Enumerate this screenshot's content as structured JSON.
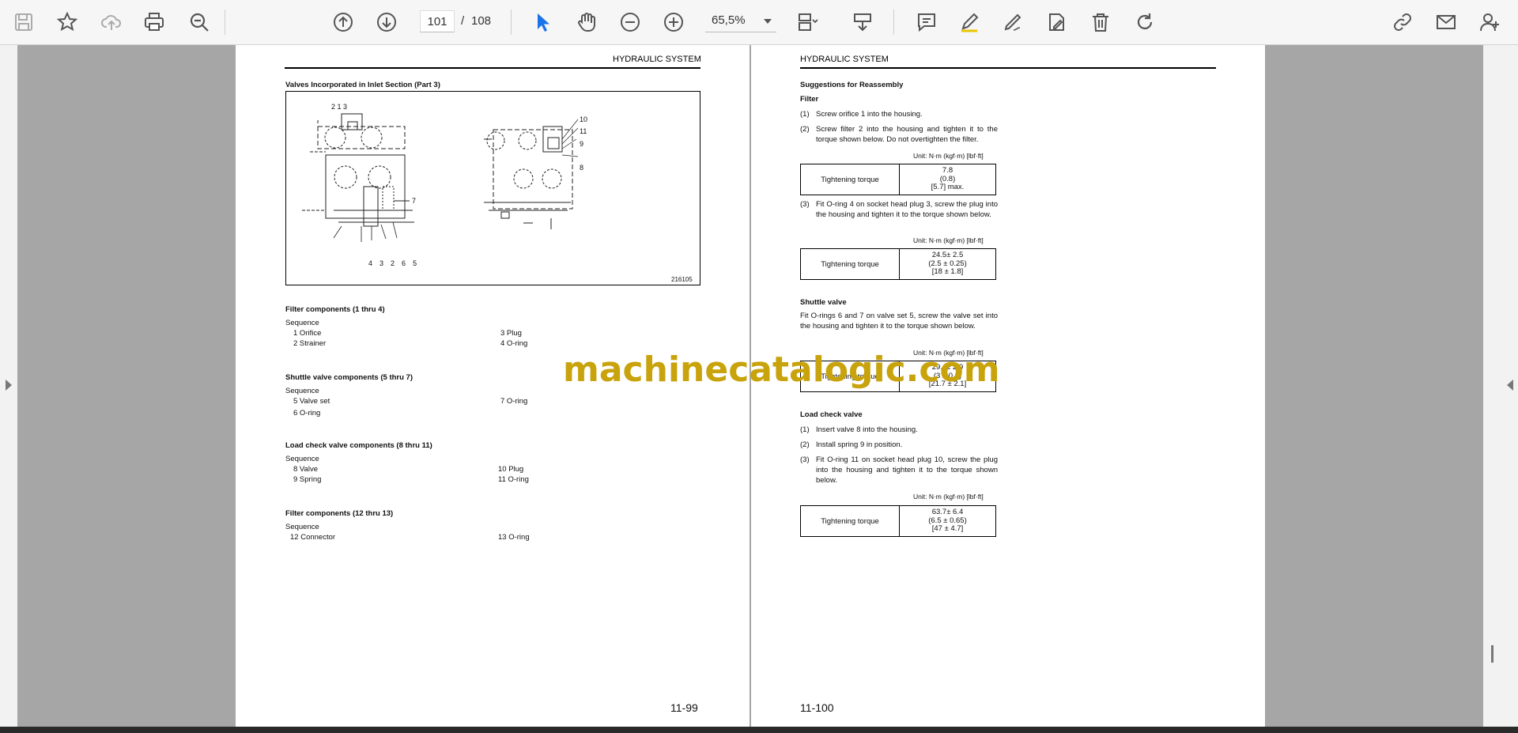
{
  "toolbar": {
    "current_page": "101",
    "page_separator": "/",
    "total_pages": "108",
    "zoom": "65,5%",
    "icons": [
      "save-icon",
      "bookmark-star-icon",
      "cloud-upload-icon",
      "print-icon",
      "zoom-search-icon",
      "page-up-icon",
      "page-down-icon",
      "select-cursor-icon",
      "hand-tool-icon",
      "zoom-out-icon",
      "zoom-in-icon",
      "page-fit-icon",
      "insert-icon",
      "comment-icon",
      "highlight-pen-icon",
      "sign-icon",
      "fill-sign-icon",
      "delete-icon",
      "redo-icon",
      "share-link-icon",
      "email-icon",
      "add-user-icon"
    ]
  },
  "left_page": {
    "header": "HYDRAULIC SYSTEM",
    "figure_title": "Valves Incorporated in Inlet Section (Part 3)",
    "figure_number": "216105",
    "callouts_left_top": "2 1 3",
    "callouts_left_bottom": [
      "4",
      "3",
      "2",
      "6",
      "5"
    ],
    "callout_left_side": "7",
    "callouts_right": [
      "10",
      "11",
      "9",
      "8"
    ],
    "groups": [
      {
        "title": "Filter components (1 thru 4)",
        "sequence": "Sequence",
        "col1": [
          "1  Orifice",
          "2  Strainer"
        ],
        "col2": [
          "3  Plug",
          "4  O-ring"
        ]
      },
      {
        "title": "Shuttle valve components (5 thru 7)",
        "sequence": "Sequence",
        "col1": [
          "5  Valve set",
          "6  O-ring"
        ],
        "col2": [
          "7  O-ring"
        ]
      },
      {
        "title": "Load check valve components (8 thru 11)",
        "sequence": "Sequence",
        "col1": [
          "8  Valve",
          "9  Spring"
        ],
        "col2": [
          "10 Plug",
          "11 O-ring"
        ]
      },
      {
        "title": "Filter components (12 thru 13)",
        "sequence": "Sequence",
        "col1": [
          "12 Connector"
        ],
        "col2": [
          "13 O-ring"
        ]
      }
    ],
    "page_number": "11-99"
  },
  "right_page": {
    "header": "HYDRAULIC SYSTEM",
    "section_title": "Suggestions for Reassembly",
    "filter_title": "Filter",
    "filter_steps": [
      {
        "n": "(1)",
        "text": "Screw orifice 1 into the housing."
      },
      {
        "n": "(2)",
        "text": "Screw filter 2 into the housing and tighten it to the torque shown below. Do not overtighten the filter."
      }
    ],
    "unit": "Unit: N·m (kgf·m) [lbf·ft]",
    "torque_label": "Tightening torque",
    "torque1": [
      "7.8",
      "(0.8)",
      "[5.7] max."
    ],
    "filter_step3": {
      "n": "(3)",
      "text": "Fit O-ring 4 on socket head plug 3, screw the plug into the housing and tighten it to the torque shown below."
    },
    "torque2": [
      "24.5± 2.5",
      "(2.5 ± 0.25)",
      "[18 ± 1.8]"
    ],
    "shuttle_title": "Shuttle valve",
    "shuttle_text": "Fit O-rings 6 and 7 on valve set 5, screw the valve set into the housing and tighten it to the torque shown below.",
    "torque3": [
      "29.4± 2.9",
      "(3 ± 0.3)",
      "[21.7 ± 2.1]"
    ],
    "load_title": "Load check valve",
    "load_steps": [
      {
        "n": "(1)",
        "text": "Insert valve 8 into the housing."
      },
      {
        "n": "(2)",
        "text": "Install spring 9 in position."
      },
      {
        "n": "(3)",
        "text": "Fit O-ring 11 on socket head plug 10, screw the plug into the housing and tighten it to the torque shown below."
      }
    ],
    "torque4": [
      "63.7± 6.4",
      "(6.5 ± 0.65)",
      "[47 ± 4.7]"
    ],
    "page_number": "11-100"
  },
  "watermark": "machinecatalogic.com"
}
